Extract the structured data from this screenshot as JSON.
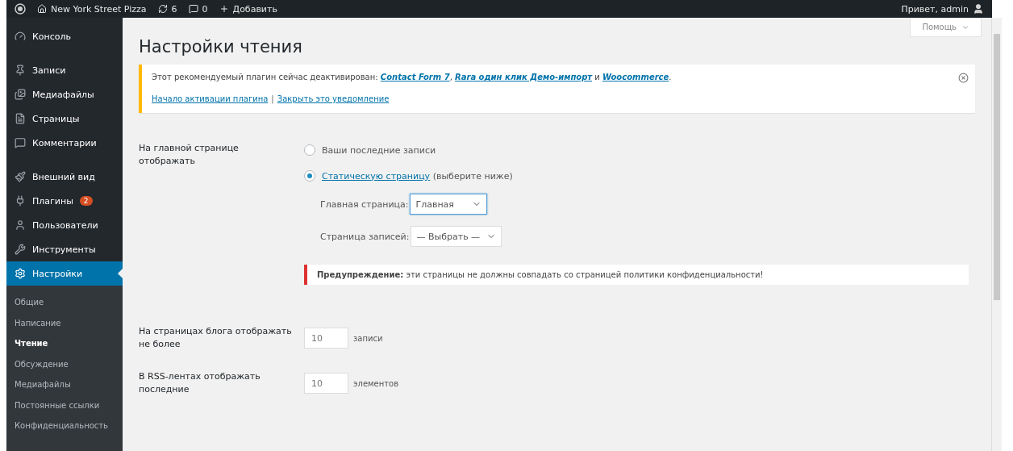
{
  "admin_bar": {
    "site": "New York Street Pizza",
    "updates": "6",
    "comments": "0",
    "add": "Добавить",
    "greeting": "Привет, admin"
  },
  "sidebar": {
    "items": [
      {
        "label": "Консоль",
        "selected": false
      },
      {
        "label": "Записи",
        "selected": false
      },
      {
        "label": "Медиафайлы",
        "selected": false
      },
      {
        "label": "Страницы",
        "selected": false
      },
      {
        "label": "Комментарии",
        "selected": false
      },
      {
        "label": "Внешний вид",
        "selected": false
      },
      {
        "label": "Плагины",
        "selected": false,
        "badge": "2"
      },
      {
        "label": "Пользователи",
        "selected": false
      },
      {
        "label": "Инструменты",
        "selected": false
      },
      {
        "label": "Настройки",
        "selected": true
      }
    ],
    "submenu": [
      {
        "label": "Общие",
        "selected": false
      },
      {
        "label": "Написание",
        "selected": false
      },
      {
        "label": "Чтение",
        "selected": true
      },
      {
        "label": "Обсуждение",
        "selected": false
      },
      {
        "label": "Медиафайлы",
        "selected": false
      },
      {
        "label": "Постоянные ссылки",
        "selected": false
      },
      {
        "label": "Конфиденциальность",
        "selected": false
      }
    ]
  },
  "help_button": "Помощь",
  "title": "Настройки чтения",
  "notice": {
    "prefix": "Этот рекомендуемый плагин сейчас деактивирован:",
    "plugins": [
      {
        "name": "Contact Form 7",
        "after": ","
      },
      {
        "name": "Rara один клик Демо-импорт",
        "after": "и"
      },
      {
        "name": "Woocommerce",
        "after": "."
      }
    ],
    "actions": [
      "Начало активации плагина",
      "Закрыть это уведомление"
    ],
    "separator": "|"
  },
  "front_page": {
    "label": "На главной странице отображать",
    "options": [
      {
        "label": "Ваши последние записи",
        "selected": false
      },
      {
        "label": "Статическую страницу",
        "note": "(выберите ниже)",
        "selected": true
      }
    ],
    "selects": [
      {
        "label": "Главная страница:",
        "value": "Главная",
        "focused": true
      },
      {
        "label": "Страница записей:",
        "value": "— Выбрать —",
        "focused": false
      }
    ],
    "warning": "**Предупреждение:** эти страницы не должны совпадать со страницей политики конфиденциальности!"
  },
  "number_rows": [
    {
      "label": "На страницах блога отображать не более",
      "value": "10",
      "unit": "записи"
    },
    {
      "label": "В RSS-лентах отображать последние",
      "value": "10",
      "unit": "элементов"
    }
  ]
}
